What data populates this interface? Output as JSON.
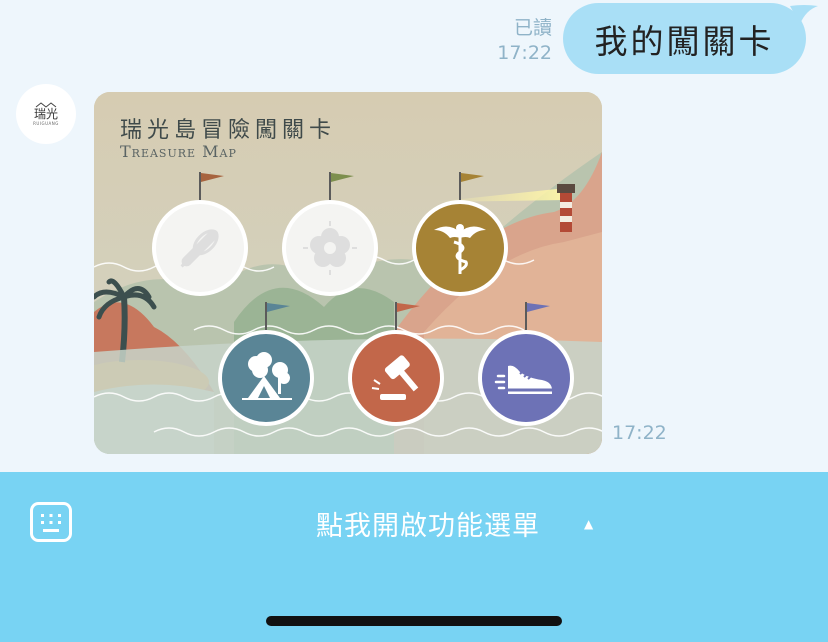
{
  "chat": {
    "outgoing": {
      "read_label": "已讀",
      "time": "17:22",
      "text": "我的闖關卡"
    },
    "incoming": {
      "avatar": {
        "logo_text": "瑞光",
        "logo_sub": "RUIGUANG"
      },
      "image": {
        "title": "瑞光島冒險闖關卡",
        "subtitle": "Treasure Map",
        "badges": [
          {
            "name": "baking",
            "icon": "rolling-pin-whisk-icon",
            "state": "incomplete",
            "color": "#f4f4f2",
            "flag_color": "#a7643f"
          },
          {
            "name": "flower",
            "icon": "flower-icon",
            "state": "incomplete",
            "color": "#f4f4f2",
            "flag_color": "#7d8f4e"
          },
          {
            "name": "medical",
            "icon": "caduceus-icon",
            "state": "completed",
            "color": "#a68335",
            "flag_color": "#a68335"
          },
          {
            "name": "camping",
            "icon": "tent-tree-icon",
            "state": "completed",
            "color": "#5a8596",
            "flag_color": "#5a8596"
          },
          {
            "name": "law",
            "icon": "gavel-icon",
            "state": "completed",
            "color": "#c2674a",
            "flag_color": "#c2674a"
          },
          {
            "name": "sports",
            "icon": "sneaker-icon",
            "state": "completed",
            "color": "#6d72b6",
            "flag_color": "#6d72b6"
          }
        ]
      },
      "time": "17:22"
    }
  },
  "menu": {
    "label": "點我開啟功能選單",
    "arrow": "▲",
    "keyboard_icon": "keyboard-icon"
  }
}
